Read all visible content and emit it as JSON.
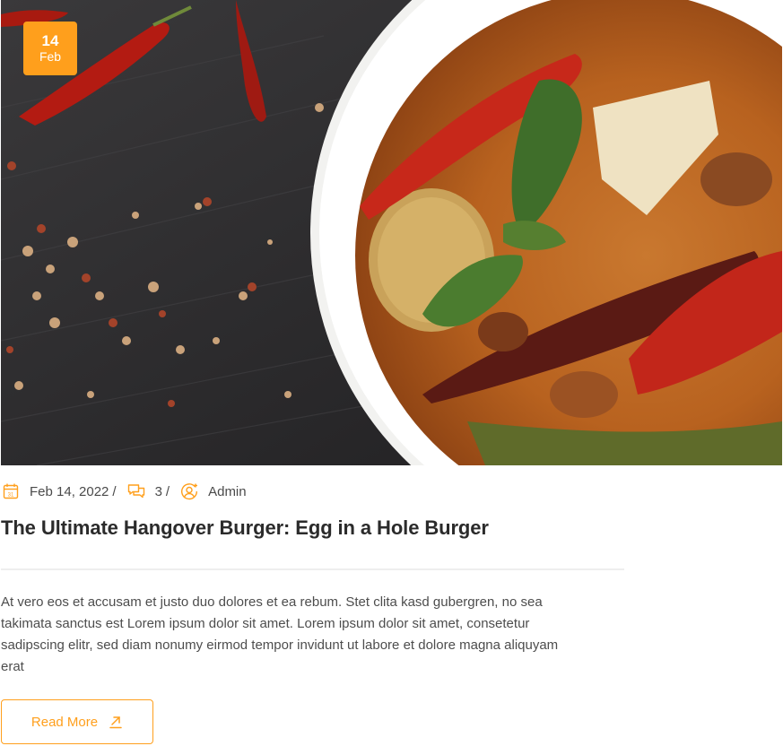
{
  "post": {
    "badge": {
      "day": "14",
      "month": "Feb"
    },
    "meta": {
      "date": "Feb 14, 2022",
      "comments": "3",
      "author": "Admin",
      "separator": "/"
    },
    "title": "The Ultimate Hangover Burger: Egg in a Hole Burger",
    "excerpt": "At vero eos et accusam et justo duo dolores et ea rebum. Stet clita kasd gubergren, no sea takimata sanctus est Lorem ipsum dolor sit amet. Lorem ipsum dolor sit amet, consetetur sadipscing elitr, sed diam nonumy eirmod tempor invidunt ut labore et dolore magna aliquyam erat",
    "read_more_label": "Read More",
    "icons": {
      "date": "calendar-icon",
      "comments": "comments-icon",
      "author": "user-icon",
      "read_more": "arrow-up-right-icon"
    }
  },
  "colors": {
    "accent": "#ff9f1c",
    "title": "#2b2b2b",
    "text": "#4d4d4d",
    "divider": "#eeeeee"
  }
}
